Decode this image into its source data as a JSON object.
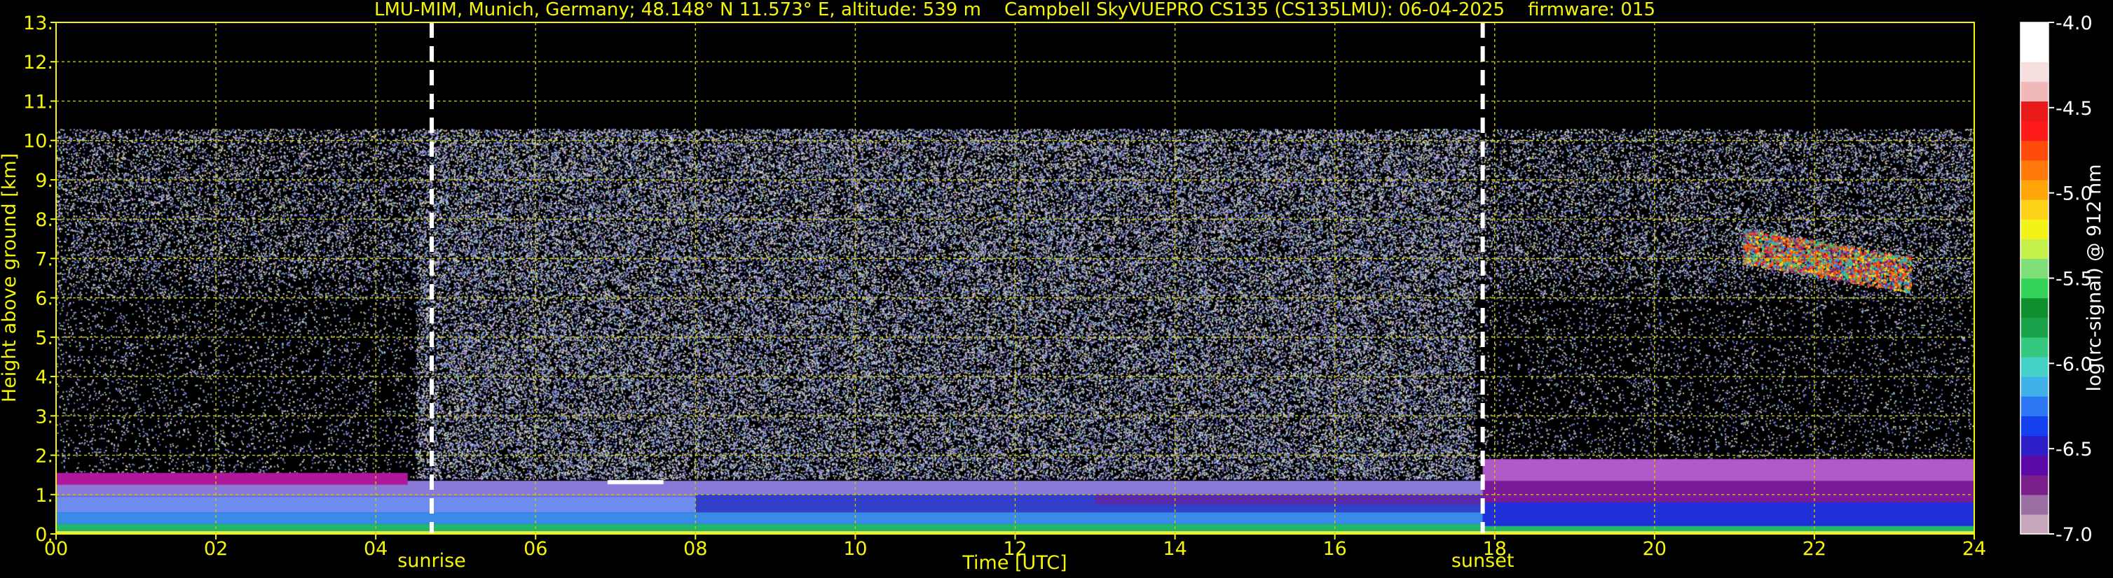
{
  "chart_data": {
    "type": "heatmap",
    "title": "LMU-MIM, Munich, Germany; 48.148° N 11.573° E, altitude: 539 m    Campbell SkyVUEPRO CS135 (CS135LMU): 06-04-2025    firmware: 015",
    "xlabel": "Time [UTC]",
    "ylabel": "Height above ground [km]",
    "xlim": [
      0,
      24
    ],
    "ylim": [
      0,
      13
    ],
    "x_ticks": [
      "00",
      "02",
      "04",
      "06",
      "08",
      "10",
      "12",
      "14",
      "16",
      "18",
      "20",
      "22",
      "24"
    ],
    "y_ticks": [
      "0.",
      "1.",
      "2.",
      "3.",
      "4.",
      "5.",
      "6.",
      "7.",
      "8.",
      "9.",
      "10.",
      "11.",
      "12.",
      "13."
    ],
    "grid": true,
    "markers": [
      {
        "label": "sunrise",
        "x": 4.7
      },
      {
        "label": "sunset",
        "x": 17.85
      }
    ],
    "signal_ceiling_km": 10.3,
    "colorbar": {
      "label": "log(rc-signal) @ 912 nm",
      "ticks": [
        "-4.0",
        "-4.5",
        "-5.0",
        "-5.5",
        "-6.0",
        "-6.5",
        "-7.0"
      ],
      "range": [
        -7.0,
        -4.0
      ],
      "colors": [
        "#c6a7bb",
        "#9b6fa3",
        "#7a1f8c",
        "#5b0aa8",
        "#2d1ec8",
        "#1540ee",
        "#2d78f5",
        "#3fb0e8",
        "#45d0c8",
        "#35c880",
        "#1aa34a",
        "#0f8f2e",
        "#35d35a",
        "#7fe07a",
        "#c5f04a",
        "#f3f31a",
        "#ffd21a",
        "#ffa50a",
        "#ff7a0a",
        "#ff4a0a",
        "#ff1a1a",
        "#e81a1a",
        "#f0b8b8",
        "#f6dede",
        "#ffffff",
        "#ffffff"
      ]
    },
    "features": [
      {
        "label": "",
        "type": "aerosol-layer",
        "x": [
          0,
          24
        ],
        "y": [
          0,
          1.5
        ]
      },
      {
        "label": "",
        "type": "cloud",
        "x": [
          21.1,
          23.2
        ],
        "y": [
          6.2,
          8.1
        ]
      }
    ]
  },
  "colors": {
    "axis": "#f5f50a",
    "grid": "#c8c800",
    "background": "#000000",
    "marker": "#ffffff"
  }
}
